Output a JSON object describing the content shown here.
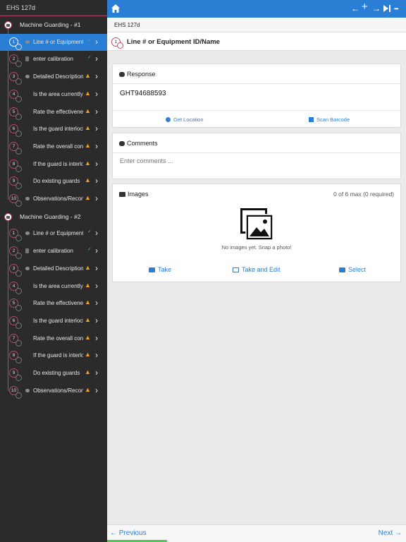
{
  "sidebar": {
    "header": "EHS 127d",
    "sections": [
      {
        "title": "Machine Guarding - #1",
        "items": [
          {
            "num": "1",
            "label": "Line # or Equipment",
            "icon": "chat-icon",
            "status": "check",
            "active": true
          },
          {
            "num": "2",
            "label": "enter calibration",
            "icon": "document-icon",
            "status": "check"
          },
          {
            "num": "3",
            "label": "Detailed Description",
            "icon": "chat-icon",
            "status": "warn"
          },
          {
            "num": "4",
            "label": "Is the area currently",
            "icon": "none",
            "status": "warn"
          },
          {
            "num": "5",
            "label": "Rate the effectiveness",
            "icon": "none",
            "status": "warn"
          },
          {
            "num": "6",
            "label": "Is the guard interlocked",
            "icon": "none",
            "status": "warn"
          },
          {
            "num": "7",
            "label": "Rate the overall condition",
            "icon": "none",
            "status": "warn"
          },
          {
            "num": "8",
            "label": "If the guard is interlocked",
            "icon": "none",
            "status": "warn"
          },
          {
            "num": "9",
            "label": "Do existing guards",
            "icon": "none",
            "status": "warn"
          },
          {
            "num": "10",
            "label": "Observations/Recommendations",
            "icon": "chat-icon",
            "status": "warn"
          }
        ]
      },
      {
        "title": "Machine Guarding - #2",
        "items": [
          {
            "num": "1",
            "label": "Line # or Equipment",
            "icon": "chat-icon",
            "status": "check"
          },
          {
            "num": "2",
            "label": "enter calibration",
            "icon": "document-icon",
            "status": "check"
          },
          {
            "num": "3",
            "label": "Detailed Description",
            "icon": "chat-icon",
            "status": "warn"
          },
          {
            "num": "4",
            "label": "Is the area currently",
            "icon": "none",
            "status": "warn"
          },
          {
            "num": "5",
            "label": "Rate the effectiveness",
            "icon": "none",
            "status": "warn"
          },
          {
            "num": "6",
            "label": "Is the guard interlocked",
            "icon": "none",
            "status": "warn"
          },
          {
            "num": "7",
            "label": "Rate the overall condition",
            "icon": "none",
            "status": "warn"
          },
          {
            "num": "8",
            "label": "If the guard is interlocked",
            "icon": "none",
            "status": "warn"
          },
          {
            "num": "9",
            "label": "Do existing guards",
            "icon": "none",
            "status": "warn"
          },
          {
            "num": "10",
            "label": "Observations/Recommendations",
            "icon": "chat-icon",
            "status": "warn"
          }
        ]
      }
    ]
  },
  "topbar": {
    "icons": [
      "home-icon",
      "arrow-left-icon",
      "plus-icon",
      "arrow-right-icon",
      "skip-forward-icon",
      "more-icon"
    ],
    "glyphs": {
      "back": "←",
      "add": "+",
      "forward": "→",
      "skip": "▶",
      "more": "•••"
    }
  },
  "breadcrumb": "EHS 127d",
  "question": {
    "num": "1",
    "title": "Line # or Equipment ID/Name"
  },
  "response": {
    "heading": "Response",
    "value": "GHT94688593",
    "get_location": "Get Location",
    "scan_barcode": "Scan Barcode"
  },
  "comments": {
    "heading": "Comments",
    "placeholder": "Enter comments ..."
  },
  "images": {
    "heading": "Images",
    "count": "0 of 6 max (0 required)",
    "empty": "No images yet. Snap a photo!",
    "take": "Take",
    "take_edit": "Take and Edit",
    "select": "Select"
  },
  "footer": {
    "previous": "← Previous",
    "next": "Next →"
  },
  "colors": {
    "accent": "#2a7fd4",
    "sidebar_bg": "#2b2b2b",
    "timeline": "#b7486f",
    "warning": "#f0a020",
    "progress": "#58c35c"
  }
}
